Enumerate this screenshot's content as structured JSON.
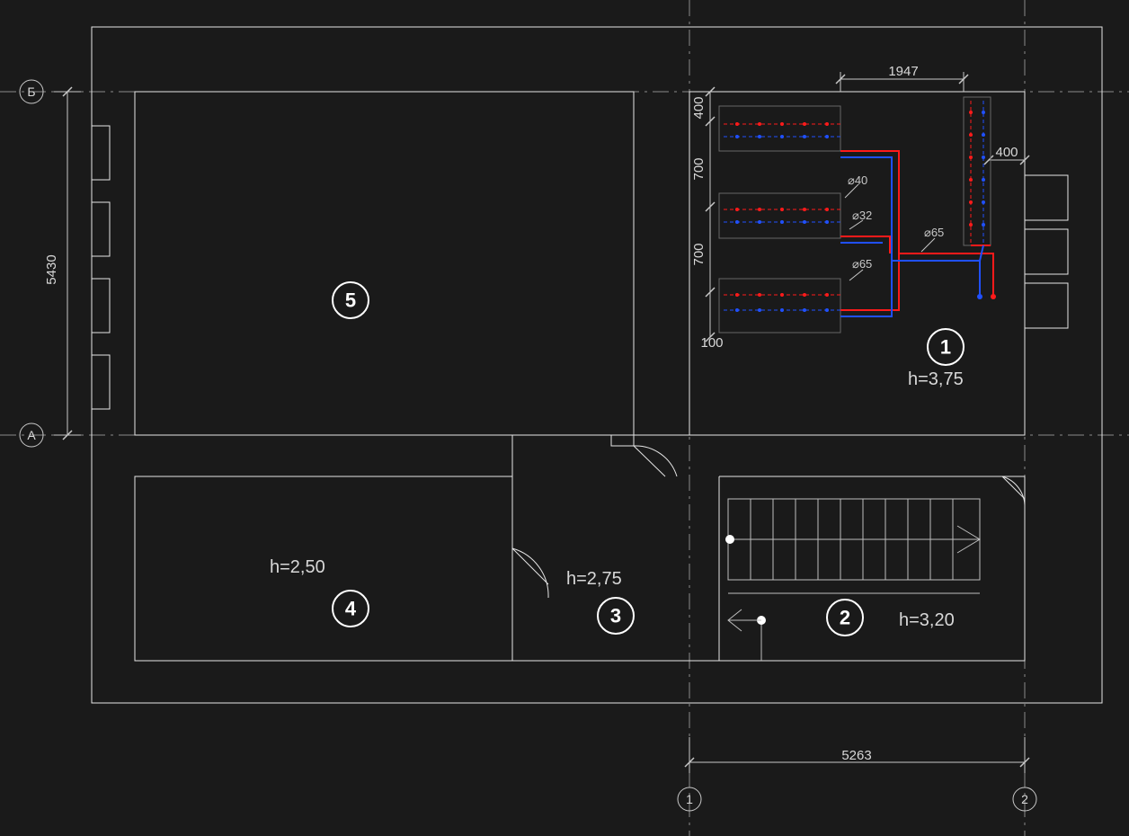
{
  "axes": {
    "top_b": "Б",
    "left_a": "А",
    "bottom_1": "1",
    "bottom_2": "2"
  },
  "rooms": {
    "r1": {
      "num": "1",
      "height_label": "h=3,75"
    },
    "r2": {
      "num": "2",
      "height_label": "h=3,20"
    },
    "r3": {
      "num": "3",
      "height_label": "h=2,75"
    },
    "r4": {
      "num": "4",
      "height_label": "h=2,50"
    },
    "r5": {
      "num": "5"
    }
  },
  "dimensions": {
    "left_vert": "5430",
    "top_right": "1947",
    "eq_left_a": "400",
    "eq_mid_1": "700",
    "eq_mid_2": "700",
    "eq_bottom": "100",
    "right_400": "400",
    "bottom_span": "5263"
  },
  "pipes": {
    "d40": "⌀40",
    "d32": "⌀32",
    "d65a": "⌀65",
    "d65b": "⌀65"
  }
}
